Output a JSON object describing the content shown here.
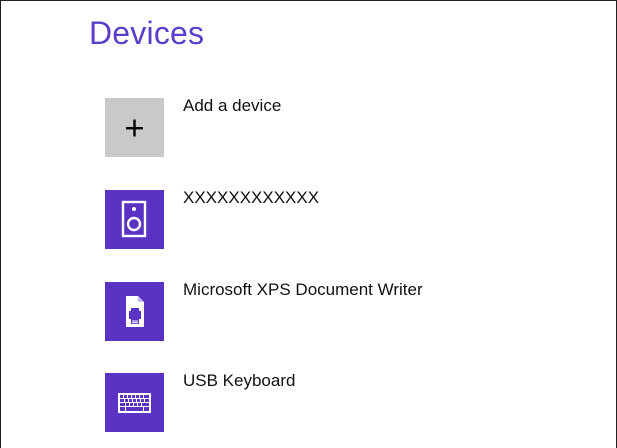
{
  "page": {
    "title": "Devices"
  },
  "devices": [
    {
      "label": "Add a device",
      "icon": "plus-icon",
      "tile_color": "#c9c9c9"
    },
    {
      "label": "XXXXXXXXXXXX",
      "icon": "speaker-icon",
      "tile_color": "#5a32c4"
    },
    {
      "label": "Microsoft XPS Document Writer",
      "icon": "printer-document-icon",
      "tile_color": "#5a32c4"
    },
    {
      "label": "USB Keyboard",
      "icon": "keyboard-icon",
      "tile_color": "#5a32c4"
    }
  ],
  "colors": {
    "accent": "#5a3ecb",
    "tile_purple": "#5a32c4",
    "tile_gray": "#c9c9c9"
  }
}
